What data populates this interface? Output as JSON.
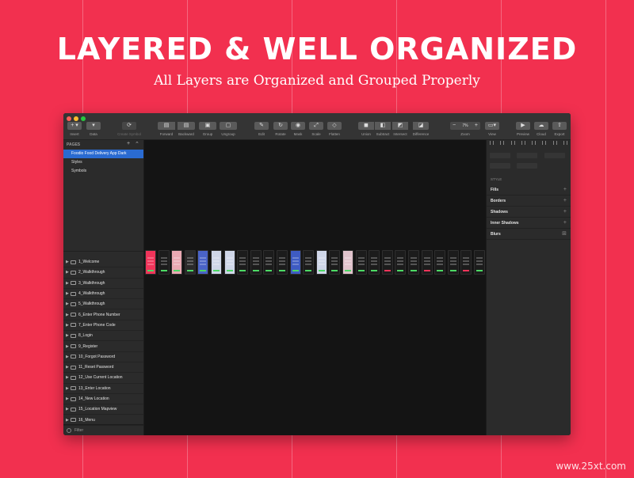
{
  "hero": {
    "title": "LAYERED & WELL ORGANIZED",
    "subtitle": "All Layers are Organized and Grouped Properly"
  },
  "watermark": "www.25xt.com",
  "colors": {
    "background": "#f2304f",
    "accent_blue": "#2a6bd1",
    "app_red": "#f0345a",
    "app_green": "#4cd964"
  },
  "toolbar": {
    "insert": {
      "label": "Insert",
      "icon": "plus-icon",
      "glyph": "+ ▾"
    },
    "data": {
      "label": "Data",
      "icon": "data-icon",
      "glyph": "▾"
    },
    "create_symbol": {
      "label": "Create Symbol",
      "icon": "create-symbol-icon"
    },
    "forward": {
      "label": "Forward",
      "icon": "forward-icon"
    },
    "backward": {
      "label": "Backward",
      "icon": "backward-icon"
    },
    "group": {
      "label": "Group",
      "icon": "group-icon"
    },
    "ungroup": {
      "label": "Ungroup",
      "icon": "ungroup-icon"
    },
    "edit": {
      "label": "Edit",
      "icon": "edit-icon"
    },
    "rotate": {
      "label": "Rotate",
      "icon": "rotate-icon"
    },
    "mask": {
      "label": "Mask",
      "icon": "mask-icon"
    },
    "scale": {
      "label": "Scale",
      "icon": "scale-icon"
    },
    "flatten": {
      "label": "Flatten",
      "icon": "flatten-icon"
    },
    "union": {
      "label": "Union",
      "icon": "union-icon"
    },
    "subtract": {
      "label": "Subtract",
      "icon": "subtract-icon"
    },
    "intersect": {
      "label": "Intersect",
      "icon": "intersect-icon"
    },
    "difference": {
      "label": "Difference",
      "icon": "difference-icon"
    },
    "zoom": {
      "label": "Zoom",
      "value": "7%",
      "minus": "−",
      "plus": "+"
    },
    "view": {
      "label": "View",
      "icon": "view-icon"
    },
    "preview": {
      "label": "Preview",
      "icon": "play-icon",
      "glyph": "▶"
    },
    "cloud": {
      "label": "Cloud",
      "icon": "cloud-icon",
      "glyph": "☁"
    },
    "export": {
      "label": "Export",
      "icon": "export-icon",
      "glyph": "⇧"
    }
  },
  "pages": {
    "header": "PAGES",
    "add": "+",
    "collapse": "⌃",
    "items": [
      "Foodio Food Delivery App Dark",
      "Styles",
      "Symbols"
    ],
    "selected_index": 0
  },
  "layers": [
    "1_Welcome",
    "2_Walkthrough",
    "3_Walkthrough",
    "4_Walkthrough",
    "5_Walkthrough",
    "6_Enter Phone Number",
    "7_Enter Phone Code",
    "8_Login",
    "9_Register",
    "10_Forgot Password",
    "11_Reset Password",
    "12_Use Current Location",
    "13_Enter Location",
    "14_New Location",
    "15_Location Mapview",
    "16_Menu"
  ],
  "filter": {
    "label": "Filter",
    "icon": "filter-icon"
  },
  "inspector": {
    "style_header": "STYLE",
    "sections": [
      {
        "label": "Fills",
        "action": "+"
      },
      {
        "label": "Borders",
        "action": "+"
      },
      {
        "label": "Shadows",
        "action": "+"
      },
      {
        "label": "Inner Shadows",
        "action": "+"
      },
      {
        "label": "Blurs",
        "action": "⊞"
      }
    ]
  }
}
